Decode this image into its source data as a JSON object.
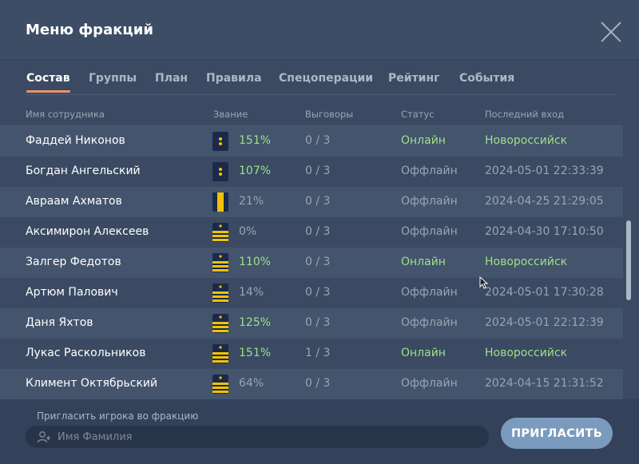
{
  "window": {
    "title": "Меню фракций"
  },
  "tabs": [
    {
      "label": "Состав",
      "active": true
    },
    {
      "label": "Группы"
    },
    {
      "label": "План"
    },
    {
      "label": "Правила"
    },
    {
      "label": "Спецоперации"
    },
    {
      "label": "Рейтинг"
    },
    {
      "label": "События"
    }
  ],
  "table": {
    "columns": {
      "name": "Имя сотрудника",
      "rank": "Звание",
      "warnings": "Выговоры",
      "status": "Статус",
      "last_login": "Последний вход"
    },
    "rows": [
      {
        "name": "Фаддей Никонов",
        "rank_icon": "rank-epaulette-stars",
        "percent": "151%",
        "warnings": "0 / 3",
        "status": "Онлайн",
        "last": "Новороссийск"
      },
      {
        "name": "Богдан Ангельский",
        "rank_icon": "rank-epaulette-stars",
        "percent": "107%",
        "warnings": "0 / 3",
        "status": "Оффлайн",
        "last": "2024-05-01 22:33:39"
      },
      {
        "name": "Авраам Ахматов",
        "rank_icon": "rank-epaulette-stripe",
        "percent": "21%",
        "warnings": "0 / 3",
        "status": "Оффлайн",
        "last": "2024-04-25 21:29:05"
      },
      {
        "name": "Аксимирон Алексеев",
        "rank_icon": "rank-epaulette-bars",
        "percent": "0%",
        "warnings": "0 / 3",
        "status": "Оффлайн",
        "last": "2024-04-30 17:10:50"
      },
      {
        "name": "Залгер Федотов",
        "rank_icon": "rank-epaulette-bars",
        "percent": "110%",
        "warnings": "0 / 3",
        "status": "Онлайн",
        "last": "Новороссийск"
      },
      {
        "name": "Артюм Палович",
        "rank_icon": "rank-epaulette-bars",
        "percent": "14%",
        "warnings": "0 / 3",
        "status": "Оффлайн",
        "last": "2024-05-01 17:30:28"
      },
      {
        "name": "Даня Яхтов",
        "rank_icon": "rank-epaulette-bars",
        "percent": "125%",
        "warnings": "0 / 3",
        "status": "Оффлайн",
        "last": "2024-05-01 22:12:39"
      },
      {
        "name": "Лукас Раскольников",
        "rank_icon": "rank-epaulette-bars",
        "percent": "151%",
        "warnings": "1 / 3",
        "status": "Онлайн",
        "last": "Новороссийск"
      },
      {
        "name": "Климент Октябрьский",
        "rank_icon": "rank-epaulette-bars",
        "percent": "64%",
        "warnings": "0 / 3",
        "status": "Оффлайн",
        "last": "2024-04-15 21:31:52"
      }
    ]
  },
  "invite": {
    "label": "Пригласить игрока во фракцию",
    "placeholder": "Имя Фамилия",
    "button": "ПРИГЛАСИТЬ"
  },
  "colors": {
    "accent": "#e8936a",
    "online": "#9ee08a",
    "muted": "#9aa4b4",
    "button": "#7a9bbd",
    "epaulette": "#1b2a4a",
    "epaulette_gold": "#f2c200"
  }
}
